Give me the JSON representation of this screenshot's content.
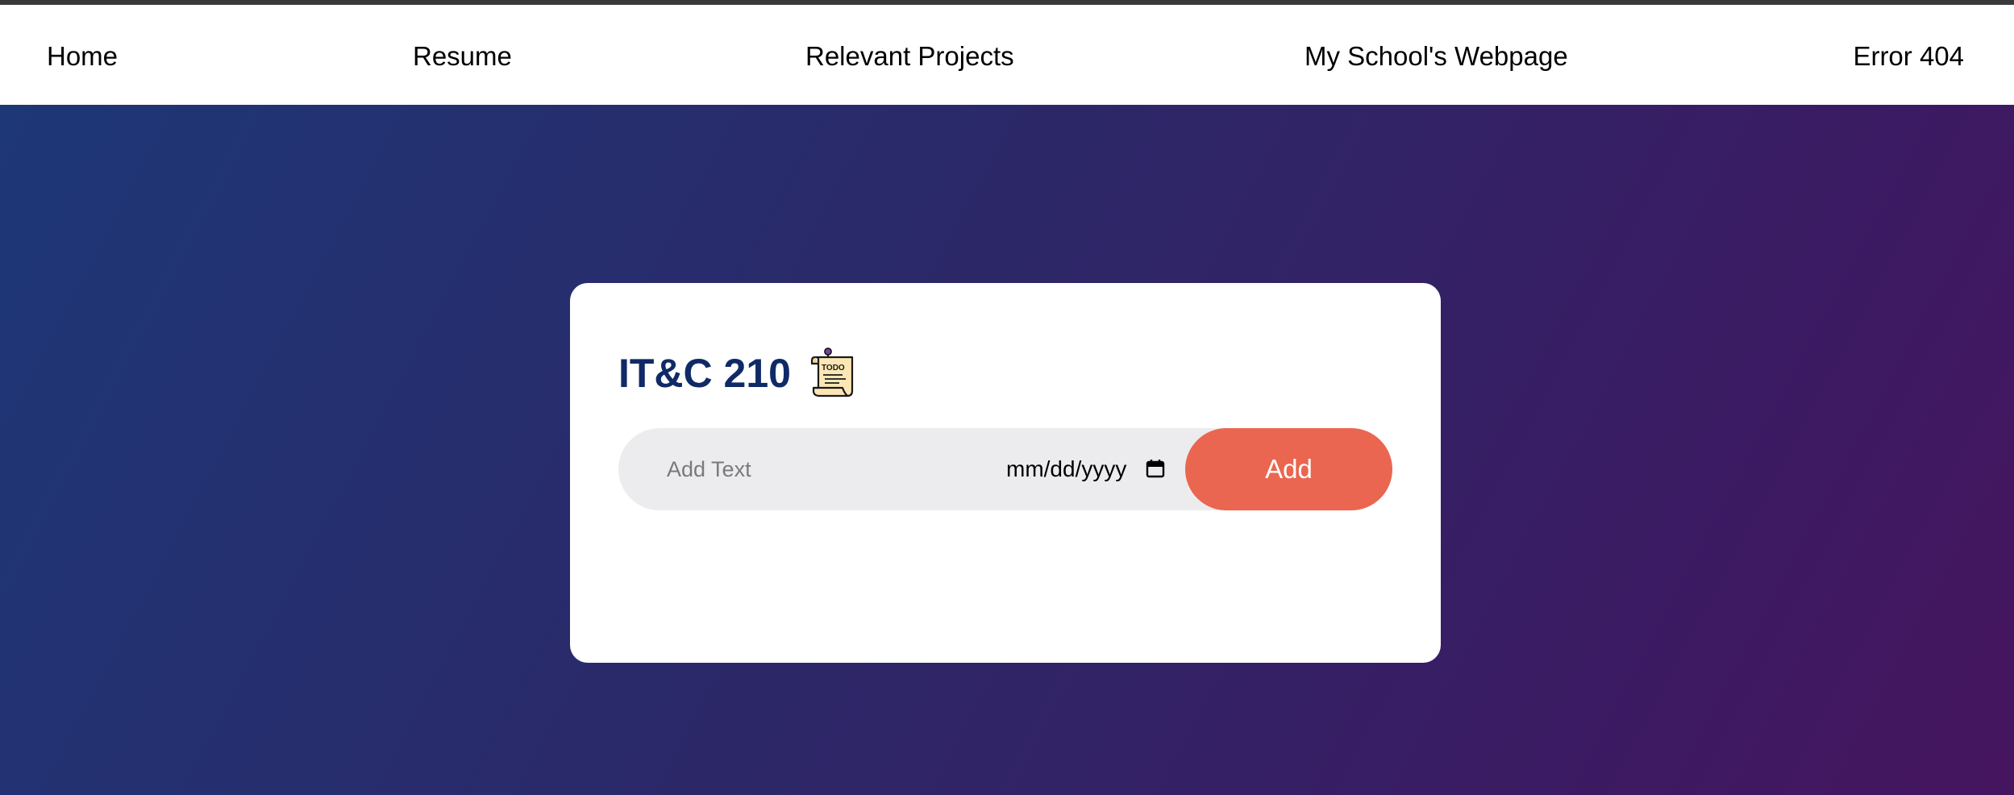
{
  "nav": {
    "items": [
      {
        "label": "Home"
      },
      {
        "label": "Resume"
      },
      {
        "label": "Relevant Projects"
      },
      {
        "label": "My School's Webpage"
      },
      {
        "label": "Error 404"
      }
    ]
  },
  "card": {
    "title": "IT&C 210",
    "title_icon": "todo-note-icon",
    "todo_icon_text": "TODO",
    "text_input": {
      "placeholder": "Add Text",
      "value": ""
    },
    "date_input": {
      "display": "mm/dd/yyyy",
      "icon": "calendar-icon"
    },
    "add_button_label": "Add"
  },
  "colors": {
    "nav_bg": "#ffffff",
    "hero_gradient_start": "#1d3777",
    "hero_gradient_end": "#46155f",
    "title_color": "#0f2a66",
    "input_bg": "#ececee",
    "add_button_bg": "#ea6650",
    "add_button_text": "#ffffff"
  }
}
